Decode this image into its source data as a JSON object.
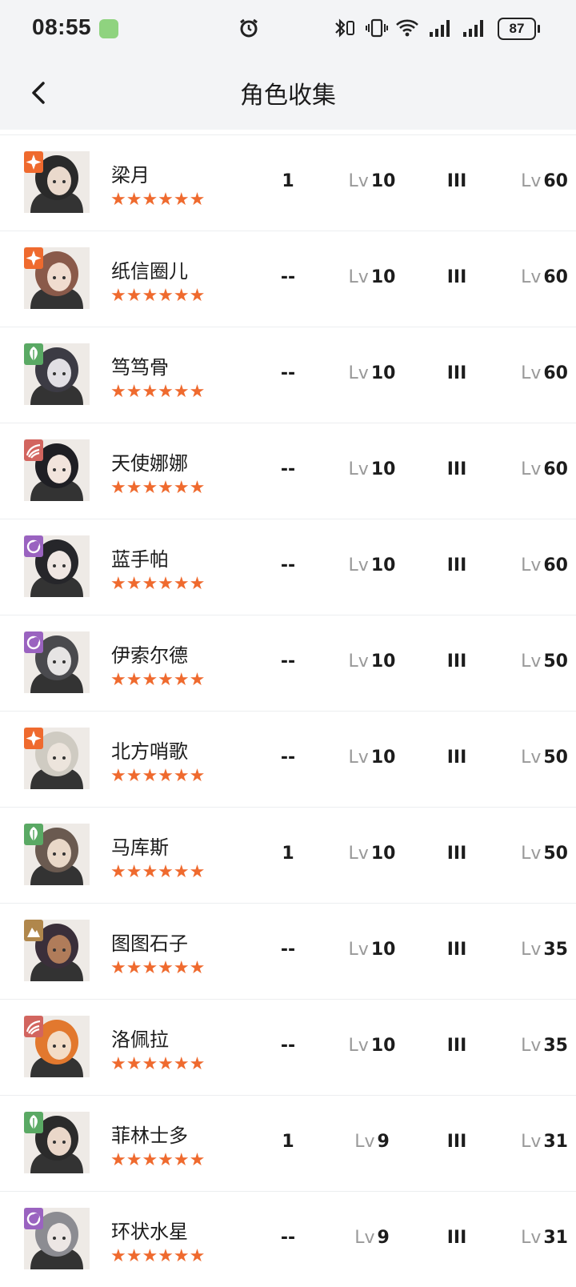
{
  "status_bar": {
    "time": "08:55",
    "battery": "87"
  },
  "header": {
    "title": "角色收集"
  },
  "colors": {
    "star": "#ef6a2e",
    "star_element": "#4c7fd0",
    "plant": "#5aa964",
    "beast": "#d2655f",
    "spirit": "#9a63c0",
    "mineral": "#b0874c"
  },
  "rows": [
    {
      "name": "梁月",
      "stars": "★★★★★★",
      "count": "1",
      "level_prefix": "Lv",
      "level": "10",
      "insight": "III",
      "max_prefix": "Lv",
      "max": "60",
      "element": "star",
      "hair": "#2a2a2a",
      "skin": "#ead9cc"
    },
    {
      "name": "纸信圈儿",
      "stars": "★★★★★★",
      "count": "--",
      "level_prefix": "Lv",
      "level": "10",
      "insight": "III",
      "max_prefix": "Lv",
      "max": "60",
      "element": "star",
      "hair": "#8a5a4a",
      "skin": "#f0dccf"
    },
    {
      "name": "笃笃骨",
      "stars": "★★★★★★",
      "count": "--",
      "level_prefix": "Lv",
      "level": "10",
      "insight": "III",
      "max_prefix": "Lv",
      "max": "60",
      "element": "plant",
      "hair": "#3c3b44",
      "skin": "#e1dfe4"
    },
    {
      "name": "天使娜娜",
      "stars": "★★★★★★",
      "count": "--",
      "level_prefix": "Lv",
      "level": "10",
      "insight": "III",
      "max_prefix": "Lv",
      "max": "60",
      "element": "beast",
      "hair": "#1f1f24",
      "skin": "#f2e4dc"
    },
    {
      "name": "蓝手帕",
      "stars": "★★★★★★",
      "count": "--",
      "level_prefix": "Lv",
      "level": "10",
      "insight": "III",
      "max_prefix": "Lv",
      "max": "60",
      "element": "spirit",
      "hair": "#26262a",
      "skin": "#efe6e2"
    },
    {
      "name": "伊索尔德",
      "stars": "★★★★★★",
      "count": "--",
      "level_prefix": "Lv",
      "level": "10",
      "insight": "III",
      "max_prefix": "Lv",
      "max": "50",
      "element": "spirit",
      "hair": "#4a4a4e",
      "skin": "#e6e4e4"
    },
    {
      "name": "北方哨歌",
      "stars": "★★★★★★",
      "count": "--",
      "level_prefix": "Lv",
      "level": "10",
      "insight": "III",
      "max_prefix": "Lv",
      "max": "50",
      "element": "star",
      "hair": "#cfcbc2",
      "skin": "#ece4dc"
    },
    {
      "name": "马库斯",
      "stars": "★★★★★★",
      "count": "1",
      "level_prefix": "Lv",
      "level": "10",
      "insight": "III",
      "max_prefix": "Lv",
      "max": "50",
      "element": "plant",
      "hair": "#6a5a50",
      "skin": "#e9d8c8"
    },
    {
      "name": "图图石子",
      "stars": "★★★★★★",
      "count": "--",
      "level_prefix": "Lv",
      "level": "10",
      "insight": "III",
      "max_prefix": "Lv",
      "max": "35",
      "element": "mineral",
      "hair": "#3a2f3a",
      "skin": "#b07c5a"
    },
    {
      "name": "洛佩拉",
      "stars": "★★★★★★",
      "count": "--",
      "level_prefix": "Lv",
      "level": "10",
      "insight": "III",
      "max_prefix": "Lv",
      "max": "35",
      "element": "beast",
      "hair": "#e2782e",
      "skin": "#f3dcc6"
    },
    {
      "name": "菲林士多",
      "stars": "★★★★★★",
      "count": "1",
      "level_prefix": "Lv",
      "level": "9",
      "insight": "III",
      "max_prefix": "Lv",
      "max": "31",
      "element": "plant",
      "hair": "#2b2b2b",
      "skin": "#ead7c9"
    },
    {
      "name": "环状水星",
      "stars": "★★★★★★",
      "count": "--",
      "level_prefix": "Lv",
      "level": "9",
      "insight": "III",
      "max_prefix": "Lv",
      "max": "31",
      "element": "spirit",
      "hair": "#8c8c92",
      "skin": "#ece6e4"
    }
  ]
}
